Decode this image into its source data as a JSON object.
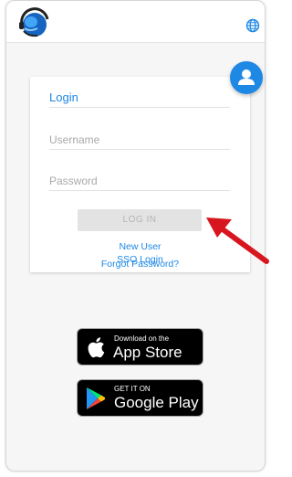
{
  "login": {
    "title": "Login",
    "username_placeholder": "Username",
    "password_placeholder": "Password",
    "login_button": "LOG IN",
    "new_user": "New User",
    "forgot_password": "Forgot Password?",
    "sso_login": "SSO Login"
  },
  "stores": {
    "apple_small": "Download on the",
    "apple_big": "App Store",
    "google_small": "GET IT ON",
    "google_big": "Google Play"
  },
  "icons": {
    "logo": "headset-globe-logo",
    "globe": "globe-icon",
    "avatar": "user-icon",
    "arrow": "red-arrow-pointer"
  },
  "colors": {
    "accent": "#1e88e5",
    "arrow": "#d8161f"
  }
}
